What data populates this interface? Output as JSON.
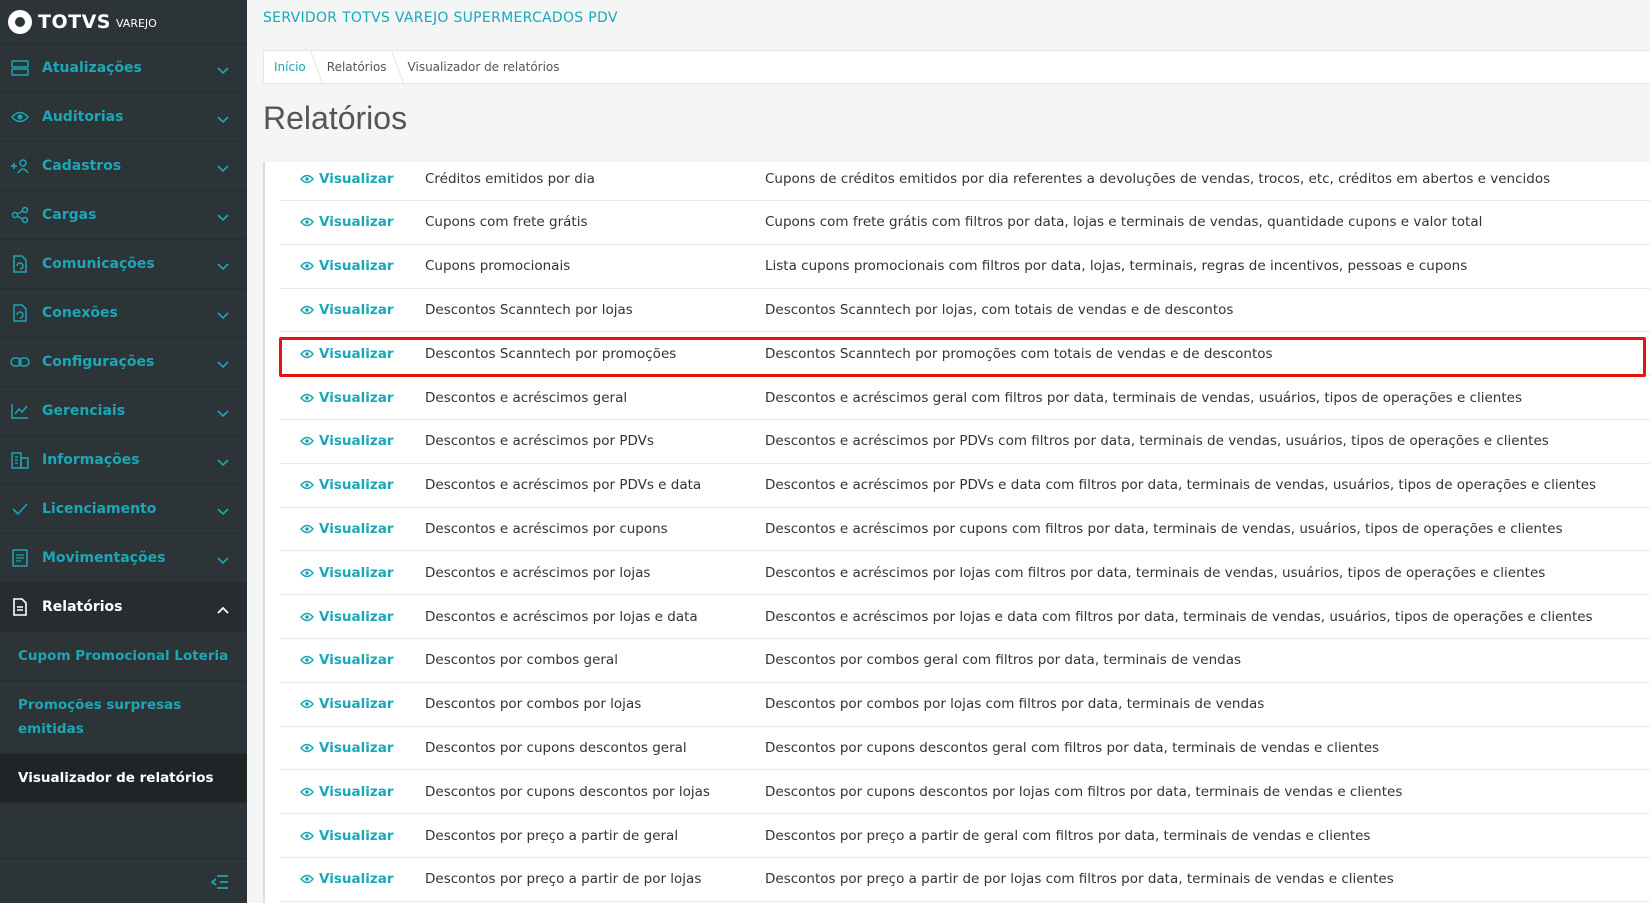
{
  "app": {
    "logo_text": "TOTVS",
    "logo_sub": "VAREJO",
    "server_title": "SERVIDOR TOTVS VAREJO SUPERMERCADOS PDV"
  },
  "sidebar": {
    "items": [
      {
        "label": "Atualizações",
        "icon": "server-icon"
      },
      {
        "label": "Auditorias",
        "icon": "eye-icon"
      },
      {
        "label": "Cadastros",
        "icon": "add-user-icon"
      },
      {
        "label": "Cargas",
        "icon": "share-icon"
      },
      {
        "label": "Comunicações",
        "icon": "file-sync-icon"
      },
      {
        "label": "Conexões",
        "icon": "file-sync-icon"
      },
      {
        "label": "Configurações",
        "icon": "link-icon"
      },
      {
        "label": "Gerenciais",
        "icon": "chart-icon"
      },
      {
        "label": "Informações",
        "icon": "building-icon"
      },
      {
        "label": "Licenciamento",
        "icon": "check-icon"
      },
      {
        "label": "Movimentações",
        "icon": "document-icon"
      },
      {
        "label": "Relatórios",
        "icon": "report-icon"
      }
    ],
    "sub_items": [
      {
        "label": "Cupom Promocional Loteria"
      },
      {
        "label": "Promoções surpresas emitidas"
      },
      {
        "label": "Visualizador de relatórios"
      }
    ]
  },
  "breadcrumb": {
    "home": "Início",
    "section": "Relatórios",
    "current": "Visualizador de relatórios"
  },
  "page": {
    "title": "Relatórios"
  },
  "table": {
    "action_label": "Visualizar",
    "rows": [
      {
        "name": "Créditos emitidos por dia",
        "desc": "Cupons de créditos emitidos por dia referentes a devoluções de vendas, trocos, etc, créditos em abertos e vencidos"
      },
      {
        "name": "Cupons com frete grátis",
        "desc": "Cupons com frete grátis com filtros por data, lojas e terminais de vendas, quantidade cupons e valor total"
      },
      {
        "name": "Cupons promocionais",
        "desc": "Lista cupons promocionais com filtros por data, lojas, terminais, regras de incentivos, pessoas e cupons"
      },
      {
        "name": "Descontos Scanntech por lojas",
        "desc": "Descontos Scanntech por lojas, com totais de vendas e de descontos"
      },
      {
        "name": "Descontos Scanntech por promoções",
        "desc": "Descontos Scanntech por promoções com totais de vendas e de descontos"
      },
      {
        "name": "Descontos e acréscimos geral",
        "desc": "Descontos e acréscimos geral com filtros por data, terminais de vendas, usuários, tipos de operações e clientes"
      },
      {
        "name": "Descontos e acréscimos por PDVs",
        "desc": "Descontos e acréscimos por PDVs com filtros por data, terminais de vendas, usuários, tipos de operações e clientes"
      },
      {
        "name": "Descontos e acréscimos por PDVs e data",
        "desc": "Descontos e acréscimos por PDVs e data com filtros por data, terminais de vendas, usuários, tipos de operações e clientes"
      },
      {
        "name": "Descontos e acréscimos por cupons",
        "desc": "Descontos e acréscimos por cupons com filtros por data, terminais de vendas, usuários, tipos de operações e clientes"
      },
      {
        "name": "Descontos e acréscimos por lojas",
        "desc": "Descontos e acréscimos por lojas com filtros por data, terminais de vendas, usuários, tipos de operações e clientes"
      },
      {
        "name": "Descontos e acréscimos por lojas e data",
        "desc": "Descontos e acréscimos por lojas e data com filtros por data, terminais de vendas, usuários, tipos de operações e clientes"
      },
      {
        "name": "Descontos por combos geral",
        "desc": "Descontos por combos geral com filtros por data, terminais de vendas"
      },
      {
        "name": "Descontos por combos por lojas",
        "desc": "Descontos por combos por lojas com filtros por data, terminais de vendas"
      },
      {
        "name": "Descontos por cupons descontos geral",
        "desc": "Descontos por cupons descontos geral com filtros por data, terminais de vendas e clientes"
      },
      {
        "name": "Descontos por cupons descontos por lojas",
        "desc": "Descontos por cupons descontos por lojas com filtros por data, terminais de vendas e clientes"
      },
      {
        "name": "Descontos por preço a partir de geral",
        "desc": "Descontos por preço a partir de geral com filtros por data, terminais de vendas e clientes"
      },
      {
        "name": "Descontos por preço a partir de por lojas",
        "desc": "Descontos por preço a partir de por lojas com filtros por data, terminais de vendas e clientes"
      }
    ]
  },
  "colors": {
    "accent": "#1aa7b7",
    "sidebar_bg": "#2d3437",
    "highlight": "#e51414"
  }
}
